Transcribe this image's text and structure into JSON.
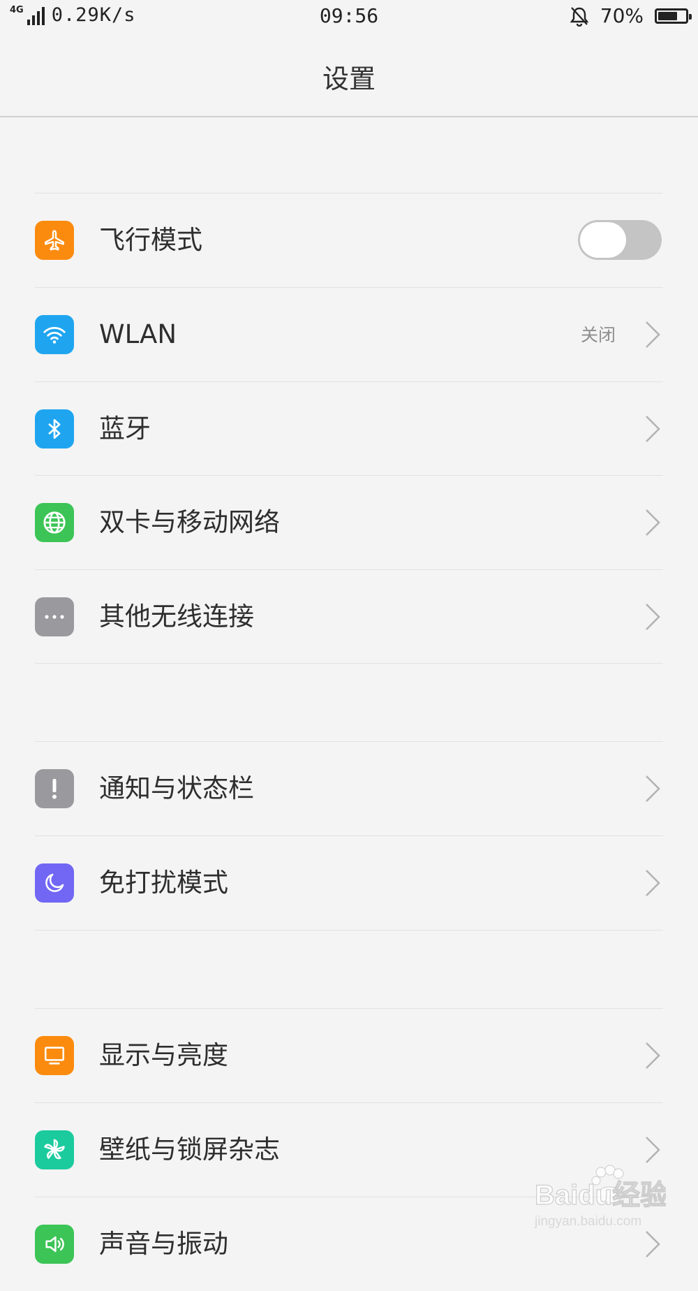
{
  "status_bar": {
    "network_type": "4G",
    "net_speed": "0.29K/s",
    "time": "09:56",
    "battery_percent": "70%",
    "battery_level": 0.7
  },
  "header": {
    "title": "设置"
  },
  "settings": {
    "items": [
      {
        "label": "飞行模式",
        "icon": "airplane-icon",
        "icon_color": "#fb8b0f",
        "toggle_on": false
      },
      {
        "label": "WLAN",
        "icon": "wifi-icon",
        "icon_color": "#1fa5f0",
        "value": "关闭"
      },
      {
        "label": "蓝牙",
        "icon": "bluetooth-icon",
        "icon_color": "#1fa5f0"
      },
      {
        "label": "双卡与移动网络",
        "icon": "globe-icon",
        "icon_color": "#3cc456"
      },
      {
        "label": "其他无线连接",
        "icon": "more-dots-icon",
        "icon_color": "#9a9a9e"
      },
      {
        "label": "通知与状态栏",
        "icon": "exclamation-icon",
        "icon_color": "#9a9a9e"
      },
      {
        "label": "免打扰模式",
        "icon": "moon-icon",
        "icon_color": "#7167f4"
      },
      {
        "label": "显示与亮度",
        "icon": "monitor-icon",
        "icon_color": "#fb8b0f"
      },
      {
        "label": "壁纸与锁屏杂志",
        "icon": "pinwheel-icon",
        "icon_color": "#1bcb9d"
      },
      {
        "label": "声音与振动",
        "icon": "speaker-icon",
        "icon_color": "#3cc456"
      }
    ]
  },
  "watermark": {
    "brand": "Baidu经验",
    "url": "jingyan.baidu.com"
  }
}
